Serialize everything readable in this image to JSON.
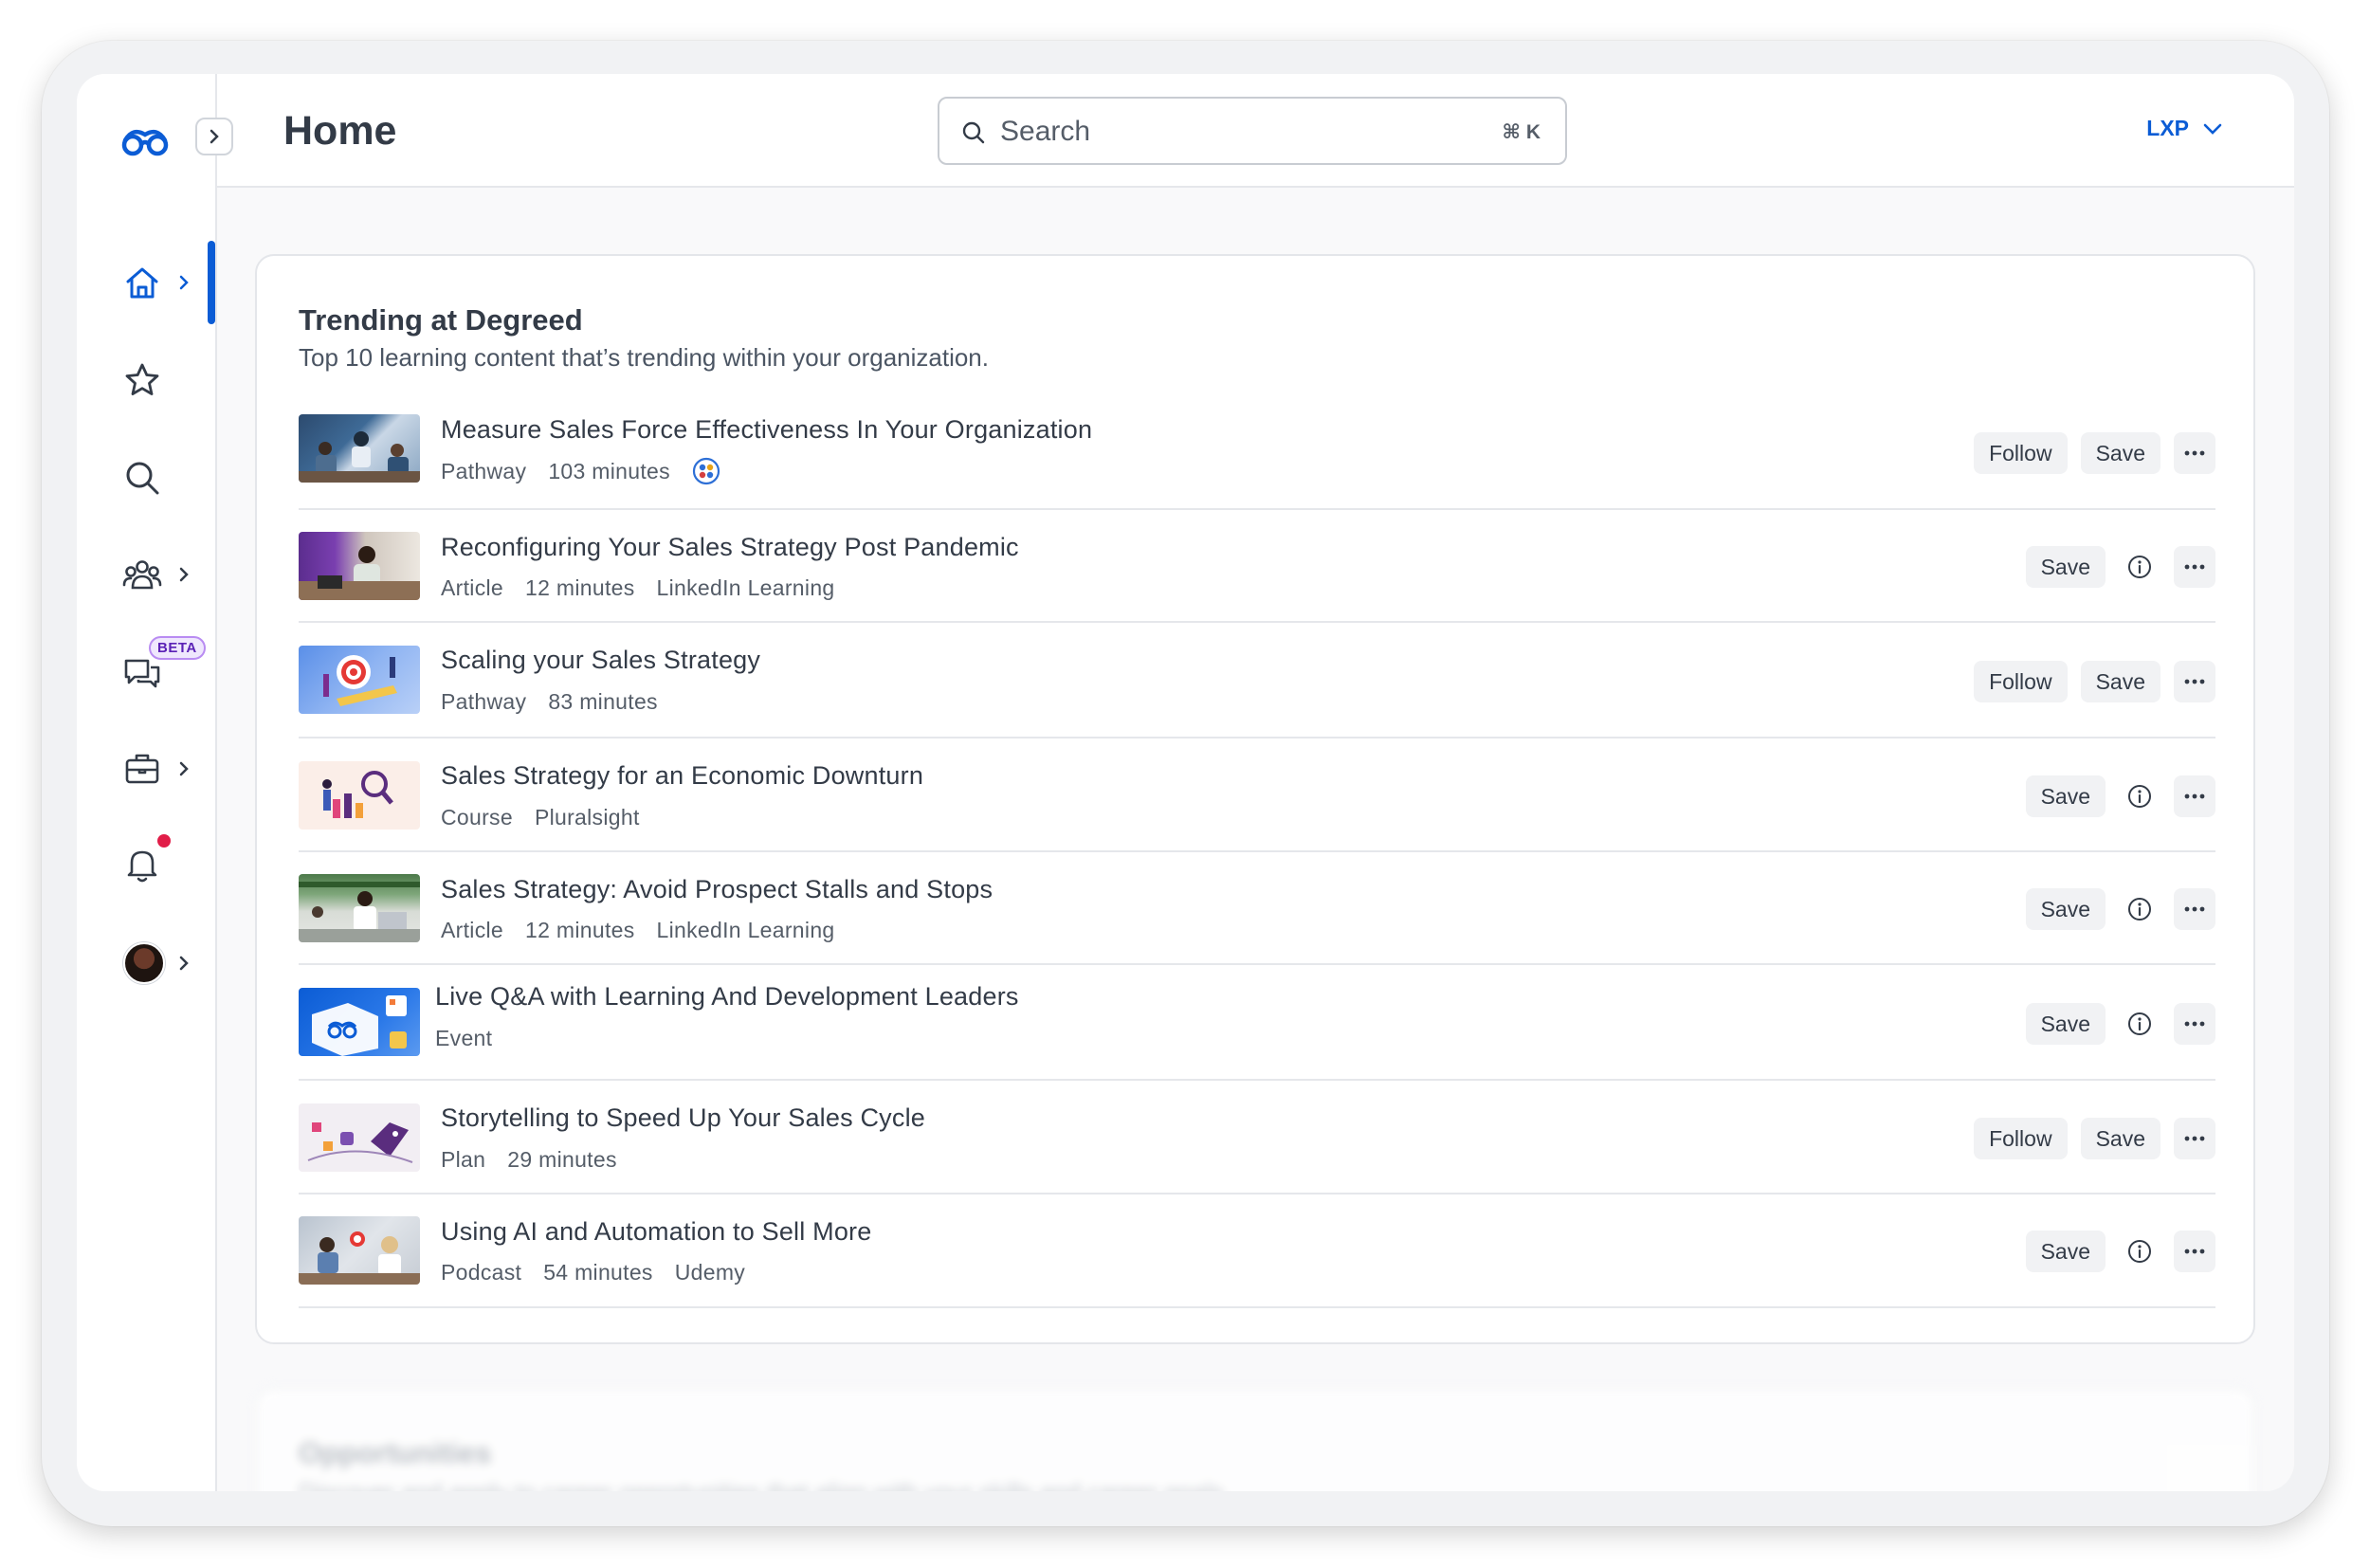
{
  "header": {
    "page_title": "Home",
    "search_placeholder": "Search",
    "search_shortcut": "⌘ K",
    "workspace": "LXP"
  },
  "sidebar": {
    "beta_label": "BETA",
    "items": [
      {
        "name": "home",
        "icon": "home-icon",
        "active": true
      },
      {
        "name": "favorites",
        "icon": "star-icon"
      },
      {
        "name": "search",
        "icon": "search-icon"
      },
      {
        "name": "groups",
        "icon": "people-icon"
      },
      {
        "name": "chat",
        "icon": "chat-icon"
      },
      {
        "name": "opportunities",
        "icon": "briefcase-icon"
      },
      {
        "name": "notifications",
        "icon": "bell-icon"
      },
      {
        "name": "profile",
        "icon": "avatar"
      }
    ]
  },
  "colors": {
    "accent": "#0b5cd5",
    "beta_bg": "#efe7fd",
    "notification": "#e11d48"
  },
  "trending": {
    "title": "Trending at Degreed",
    "subtitle": "Top 10 learning content that’s trending within your organization.",
    "follow_label": "Follow",
    "save_label": "Save",
    "items": [
      {
        "title": "Measure Sales Force Effectiveness In Your Organization",
        "type": "Pathway",
        "duration": "103 minutes",
        "provider": "",
        "provider_icon": "org-icon",
        "action": "follow"
      },
      {
        "title": "Reconfiguring Your Sales Strategy Post Pandemic",
        "type": "Article",
        "duration": "12 minutes",
        "provider": "LinkedIn Learning",
        "action": "info"
      },
      {
        "title": "Scaling your Sales Strategy",
        "type": "Pathway",
        "duration": "83 minutes",
        "provider": "",
        "action": "follow"
      },
      {
        "title": "Sales Strategy for an Economic Downturn",
        "type": "Course",
        "duration": "",
        "provider": "Pluralsight",
        "action": "info"
      },
      {
        "title": "Sales Strategy: Avoid Prospect Stalls and Stops",
        "type": "Article",
        "duration": "12 minutes",
        "provider": "LinkedIn Learning",
        "action": "info"
      },
      {
        "title": "Live Q&A with Learning And Development Leaders",
        "type": "Event",
        "duration": "",
        "provider": "",
        "action": "info"
      },
      {
        "title": "Storytelling to Speed Up Your Sales Cycle",
        "type": "Plan",
        "duration": "29 minutes",
        "provider": "",
        "action": "follow"
      },
      {
        "title": "Using AI and Automation to Sell More",
        "type": "Podcast",
        "duration": "54 minutes",
        "provider": "Udemy",
        "action": "info"
      }
    ]
  },
  "opportunities": {
    "title": "Opportunities",
    "subtitle": "Discover and apply to career opportunities that align with your skills and career goals."
  }
}
